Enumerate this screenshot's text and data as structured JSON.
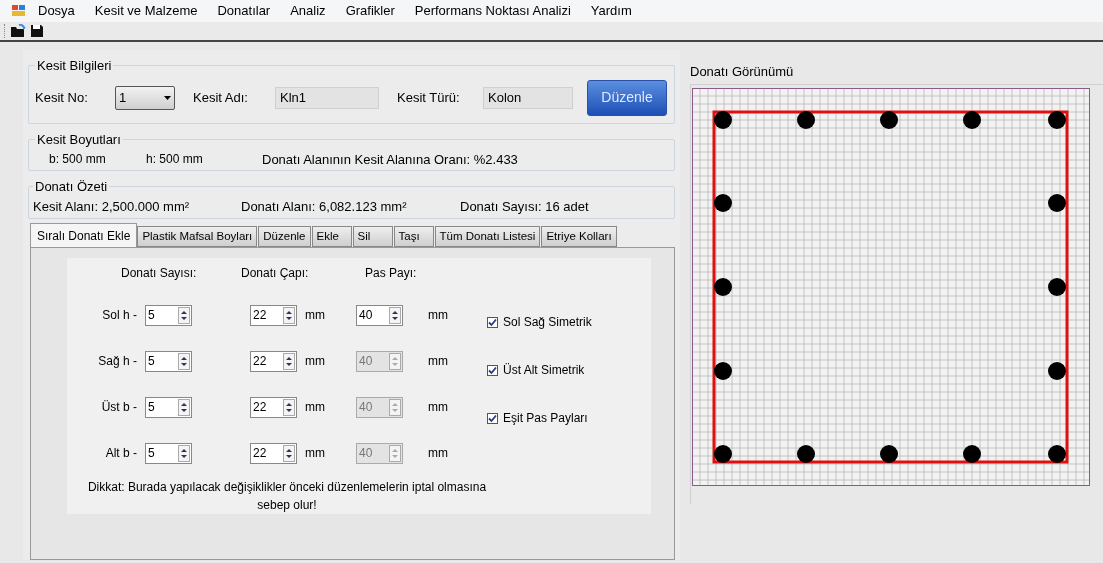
{
  "menu": [
    "Dosya",
    "Kesit ve Malzeme",
    "Donatılar",
    "Analiz",
    "Grafikler",
    "Performans Noktası Analizi",
    "Yardım"
  ],
  "section_info": {
    "title": "Kesit Bilgileri",
    "no_label": "Kesit No:",
    "no_value": "1",
    "name_label": "Kesit Adı:",
    "name_value": "Kln1",
    "type_label": "Kesit Türü:",
    "type_value": "Kolon",
    "edit_button": "Düzenle"
  },
  "dimensions": {
    "title": "Kesit Boyutları",
    "b": "b: 500 mm",
    "h": "h: 500 mm",
    "ratio": "Donatı Alanının Kesit Alanına Oranı: %2.433"
  },
  "summary": {
    "title": "Donatı Özeti",
    "section_area": "Kesit Alanı: 2,500.000 mm²",
    "rebar_area": "Donatı Alanı: 6,082.123 mm²",
    "rebar_count": "Donatı Sayısı: 16 adet"
  },
  "tabs": [
    {
      "label": "Sıralı Donatı Ekle",
      "selected": true
    },
    {
      "label": "Plastik Mafsal Boyları",
      "selected": false
    },
    {
      "label": "Düzenle",
      "selected": false
    },
    {
      "label": "Ekle",
      "selected": false
    },
    {
      "label": "Sil",
      "selected": false
    },
    {
      "label": "Taşı",
      "selected": false
    },
    {
      "label": "Tüm Donatı Listesi",
      "selected": false
    },
    {
      "label": "Etriye Kolları",
      "selected": false
    }
  ],
  "columns": [
    "Donatı Sayısı:",
    "Donatı Çapı:",
    "Pas Payı:"
  ],
  "rows": [
    {
      "label": "Sol h -",
      "count": "5",
      "diameter": "22",
      "diameter_unit": "mm",
      "cover": "40",
      "cover_disabled": false,
      "cover_unit": "mm"
    },
    {
      "label": "Sağ h -",
      "count": "5",
      "diameter": "22",
      "diameter_unit": "mm",
      "cover": "40",
      "cover_disabled": true,
      "cover_unit": "mm"
    },
    {
      "label": "Üst b -",
      "count": "5",
      "diameter": "22",
      "diameter_unit": "mm",
      "cover": "40",
      "cover_disabled": true,
      "cover_unit": "mm"
    },
    {
      "label": "Alt b -",
      "count": "5",
      "diameter": "22",
      "diameter_unit": "mm",
      "cover": "40",
      "cover_disabled": true,
      "cover_unit": "mm"
    }
  ],
  "options": [
    {
      "label": "Sol Sağ Simetrik",
      "checked": true
    },
    {
      "label": "Üst Alt Simetrik",
      "checked": true
    },
    {
      "label": "Eşit Pas Payları",
      "checked": true
    }
  ],
  "warning": "Dikkat: Burada yapılacak değişiklikler önceki düzenlemelerin iptal olmasına sebep olur!",
  "view": {
    "title": "Donatı Görünümü"
  }
}
